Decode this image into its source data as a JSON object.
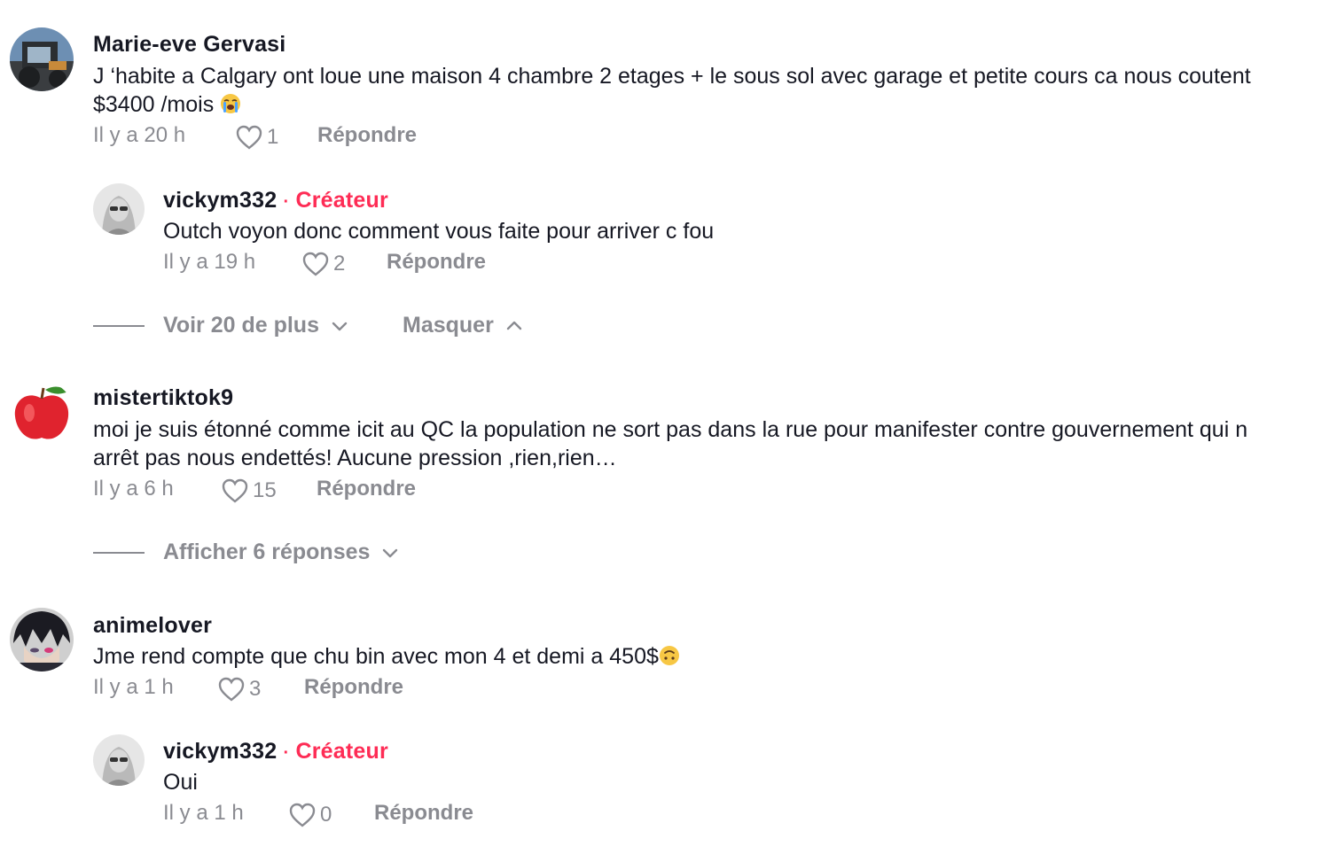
{
  "comments": [
    {
      "username": "Marie-eve Gervasi",
      "text_line1": "J ‘habite a Calgary ont loue une maison 4 chambre 2 etages + le sous sol avec garage et petite cours ca nous coutent",
      "text_line2": "$3400 /mois",
      "emoji": "crying-face",
      "time": "Il y a 20 h",
      "likes": "1",
      "reply_label": "Répondre",
      "replies": [
        {
          "username": "vickym332",
          "separator": "·",
          "badge": "Créateur",
          "text": "Outch voyon donc comment vous faite pour arriver c fou",
          "time": "Il y a 19 h",
          "likes": "2",
          "reply_label": "Répondre"
        }
      ],
      "view_more_label": "Voir 20 de plus",
      "hide_label": "Masquer"
    },
    {
      "username": "mistertiktok9",
      "text_line1": "moi je suis étonné comme icit au QC la population ne sort pas dans la rue pour manifester contre gouvernement qui n",
      "text_line2": "arrêt pas nous endettés! Aucune pression ,rien,rien…",
      "time": "Il y a 6 h",
      "likes": "15",
      "reply_label": "Répondre",
      "show_replies_label": "Afficher 6 réponses"
    },
    {
      "username": "animelover",
      "text_line1": "Jme rend compte que chu bin avec mon 4 et demi a 450$",
      "emoji": "upside-down-face",
      "time": "Il y a 1 h",
      "likes": "3",
      "reply_label": "Répondre",
      "replies": [
        {
          "username": "vickym332",
          "separator": "·",
          "badge": "Créateur",
          "text": "Oui",
          "time": "Il y a 1 h",
          "likes": "0",
          "reply_label": "Répondre"
        }
      ]
    }
  ],
  "colors": {
    "accent": "#fe2c55",
    "muted": "#8a8b91",
    "text": "#161823"
  }
}
